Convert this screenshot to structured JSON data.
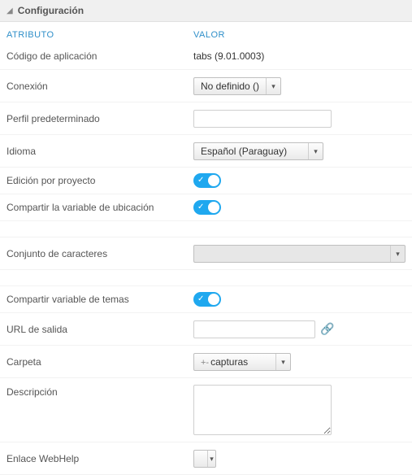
{
  "panel": {
    "title": "Configuración"
  },
  "columns": {
    "attr": "ATRIBUTO",
    "val": "VALOR"
  },
  "rows": {
    "app_code": {
      "label": "Código de aplicación",
      "value": "tabs (9.01.0003)"
    },
    "connection": {
      "label": "Conexión",
      "value": "No definido ()"
    },
    "default_profile": {
      "label": "Perfil predeterminado",
      "value": ""
    },
    "language": {
      "label": "Idioma",
      "value": "Español (Paraguay)"
    },
    "edit_project": {
      "label": "Edición por proyecto",
      "on": true
    },
    "share_location_var": {
      "label": "Compartir la variable de ubicación",
      "on": true
    },
    "charset": {
      "label": "Conjunto de caracteres",
      "value": ""
    },
    "share_theme_var": {
      "label": "Compartir variable de temas",
      "on": true
    },
    "exit_url": {
      "label": "URL de salida",
      "value": ""
    },
    "folder": {
      "label": "Carpeta",
      "value": "capturas"
    },
    "description": {
      "label": "Descripción",
      "value": ""
    },
    "webhelp": {
      "label": "Enlace WebHelp",
      "value": ""
    }
  }
}
